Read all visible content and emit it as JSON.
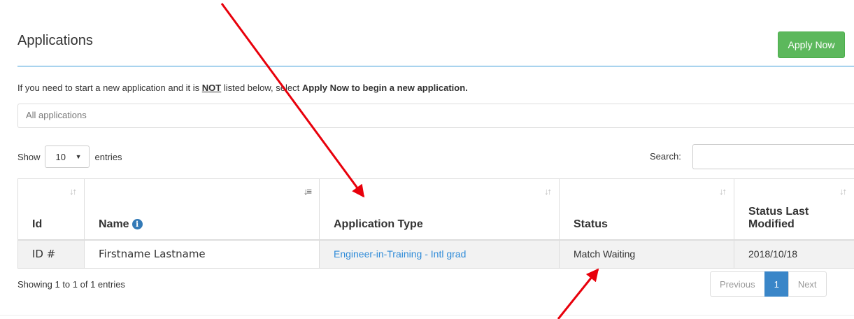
{
  "header": {
    "title": "Applications",
    "apply_button": "Apply Now"
  },
  "notice": {
    "before": "If you need to start a new application and it is ",
    "not": "NOT",
    "middle": " listed below, select ",
    "bold_end": "Apply Now to begin a new application."
  },
  "filter": {
    "value": "All applications"
  },
  "length_menu": {
    "show": "Show",
    "value": "10",
    "entries": "entries"
  },
  "search": {
    "label": "Search:",
    "value": ""
  },
  "table": {
    "columns": [
      "Id",
      "Name",
      "Application Type",
      "Status",
      "Status Last Modified"
    ],
    "rows": [
      {
        "id": "ID #",
        "name": "Firstname Lastname",
        "type": "Engineer-in-Training - Intl grad",
        "status": "Match Waiting",
        "modified": "2018/10/18"
      }
    ]
  },
  "footer": {
    "info": "Showing 1 to 1 of 1 entries",
    "previous": "Previous",
    "current_page": "1",
    "next": "Next"
  },
  "colors": {
    "primary": "#337ab7",
    "success": "#5cb85c",
    "annotation": "#e8000b"
  }
}
